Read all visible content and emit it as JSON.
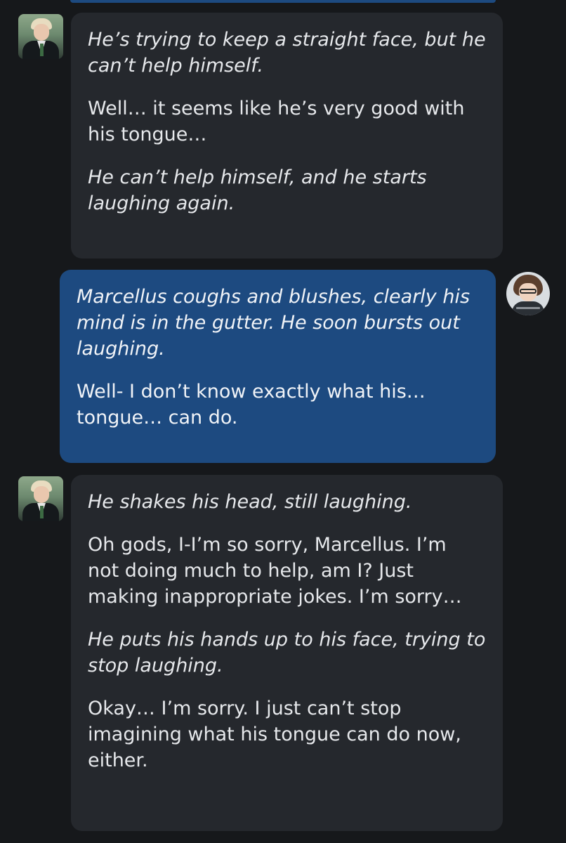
{
  "messages": [
    {
      "sender": "bot",
      "avatar_icon": "character-portrait-icon",
      "paragraphs": [
        {
          "style": "action",
          "text": "He’s trying to keep a straight face, but he\ncan’t help himself."
        },
        {
          "style": "speech",
          "text": "Well… it seems like he’s very good with\nhis tongue…"
        },
        {
          "style": "action",
          "text": "He can’t help himself, and he starts\nlaughing again."
        }
      ]
    },
    {
      "sender": "user",
      "avatar_icon": "user-avatar-icon",
      "paragraphs": [
        {
          "style": "action",
          "text": "Marcellus coughs and blushes, clearly his\nmind is in the gutter. He soon bursts out\nlaughing."
        },
        {
          "style": "speech",
          "text": "Well- I don’t know exactly what his…\ntongue… can do."
        }
      ]
    },
    {
      "sender": "bot",
      "avatar_icon": "character-portrait-icon",
      "paragraphs": [
        {
          "style": "action",
          "text": "He shakes his head, still laughing."
        },
        {
          "style": "speech",
          "text": "Oh gods, I-I’m so sorry, Marcellus. I’m\nnot doing much to help, am I? Just\nmaking inappropriate jokes. I’m sorry…"
        },
        {
          "style": "action",
          "text": "He puts his hands up to his face, trying to\nstop laughing."
        },
        {
          "style": "speech",
          "text": "Okay… I’m sorry. I just can’t stop\nimagining what his tongue can do now,\neither."
        }
      ]
    }
  ],
  "colors": {
    "background": "#16181b",
    "bot_bubble": "#25282d",
    "user_bubble": "#1d4a80",
    "text": "#e6e8eb"
  }
}
